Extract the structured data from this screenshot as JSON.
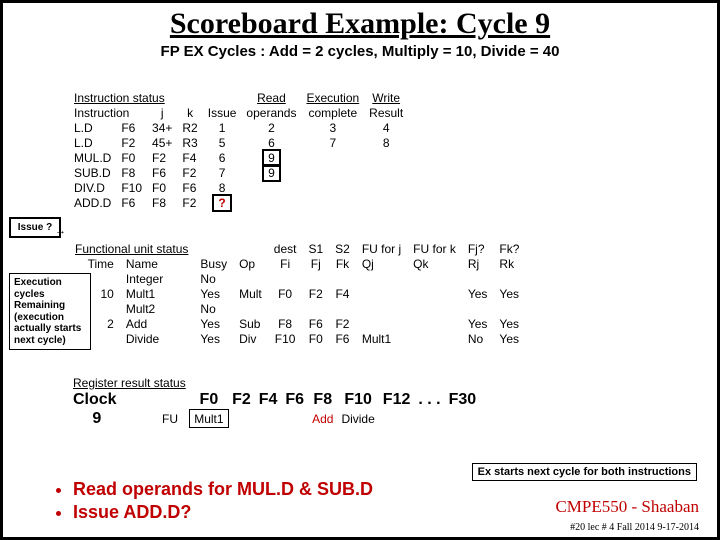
{
  "title": "Scoreboard Example:  Cycle 9",
  "subtitle": "FP EX Cycles :  Add = 2 cycles, Multiply = 10, Divide = 40",
  "issue_q": "Issue ?",
  "exec_note": "Execution cycles Remaining (execution actually starts next cycle)",
  "exstart": "Ex starts next cycle for both instructions",
  "cmpe": "CMPE550 - Shaaban",
  "lec": "#20  lec # 4 Fall 2014   9-17-2014",
  "bul1": "Read operands for MUL.D & SUB.D",
  "bul2": "Issue ADD.D?",
  "is": {
    "h0": "Instruction status",
    "h1": "Read",
    "h2": "Execution",
    "h3": "Write",
    "c0": "Instruction",
    "c1": "j",
    "c2": "k",
    "c3": "Issue",
    "c4": "operands",
    "c5": "complete",
    "c6": "Result",
    "rows": [
      {
        "op": "L.D",
        "d": "F6",
        "j": "34+",
        "k": "R2",
        "is": "1",
        "rd": "2",
        "ex": "3",
        "wr": "4"
      },
      {
        "op": "L.D",
        "d": "F2",
        "j": "45+",
        "k": "R3",
        "is": "5",
        "rd": "6",
        "ex": "7",
        "wr": "8"
      },
      {
        "op": "MUL.D",
        "d": "F0",
        "j": "F2",
        "k": "F4",
        "is": "6",
        "rd": "9",
        "ex": "",
        "wr": ""
      },
      {
        "op": "SUB.D",
        "d": "F8",
        "j": "F6",
        "k": "F2",
        "is": "7",
        "rd": "9",
        "ex": "",
        "wr": ""
      },
      {
        "op": "DIV.D",
        "d": "F10",
        "j": "F0",
        "k": "F6",
        "is": "8",
        "rd": "",
        "ex": "",
        "wr": ""
      },
      {
        "op": "ADD.D",
        "d": "F6",
        "j": "F8",
        "k": "F2",
        "is": "?",
        "rd": "",
        "ex": "",
        "wr": ""
      }
    ]
  },
  "fu": {
    "h0": "Functional unit status",
    "c0": "Time",
    "c1": "Name",
    "c2": "Busy",
    "c3": "Op",
    "c4": "dest",
    "c5": "S1",
    "c6": "S2",
    "c7": "FU for j",
    "c8": "FU for k",
    "c9": "Fj?",
    "c10": "Fk?",
    "c4b": "Fi",
    "c5b": "Fj",
    "c6b": "Fk",
    "c7b": "Qj",
    "c8b": "Qk",
    "c9b": "Rj",
    "c10b": "Rk",
    "rows": [
      {
        "t": "",
        "n": "Integer",
        "b": "No",
        "op": "",
        "fi": "",
        "fj": "",
        "fk": "",
        "qj": "",
        "qk": "",
        "rj": "",
        "rk": ""
      },
      {
        "t": "10",
        "n": "Mult1",
        "b": "Yes",
        "op": "Mult",
        "fi": "F0",
        "fj": "F2",
        "fk": "F4",
        "qj": "",
        "qk": "",
        "rj": "Yes",
        "rk": "Yes"
      },
      {
        "t": "",
        "n": "Mult2",
        "b": "No",
        "op": "",
        "fi": "",
        "fj": "",
        "fk": "",
        "qj": "",
        "qk": "",
        "rj": "",
        "rk": ""
      },
      {
        "t": "2",
        "n": "Add",
        "b": "Yes",
        "op": "Sub",
        "fi": "F8",
        "fj": "F6",
        "fk": "F2",
        "qj": "",
        "qk": "",
        "rj": "Yes",
        "rk": "Yes"
      },
      {
        "t": "",
        "n": "Divide",
        "b": "Yes",
        "op": "Div",
        "fi": "F10",
        "fj": "F0",
        "fk": "F6",
        "qj": "Mult1",
        "qk": "",
        "rj": "No",
        "rk": "Yes"
      }
    ]
  },
  "reg": {
    "h": "Register result status",
    "clock": "Clock",
    "cv": "9",
    "fu": "FU",
    "cols": [
      "F0",
      "F2",
      "F4",
      "F6",
      "F8",
      "F10",
      "F12",
      ". . .",
      "F30"
    ],
    "vals": [
      "Mult1",
      "",
      "",
      "",
      "Add",
      "Divide",
      "",
      "",
      ""
    ]
  }
}
